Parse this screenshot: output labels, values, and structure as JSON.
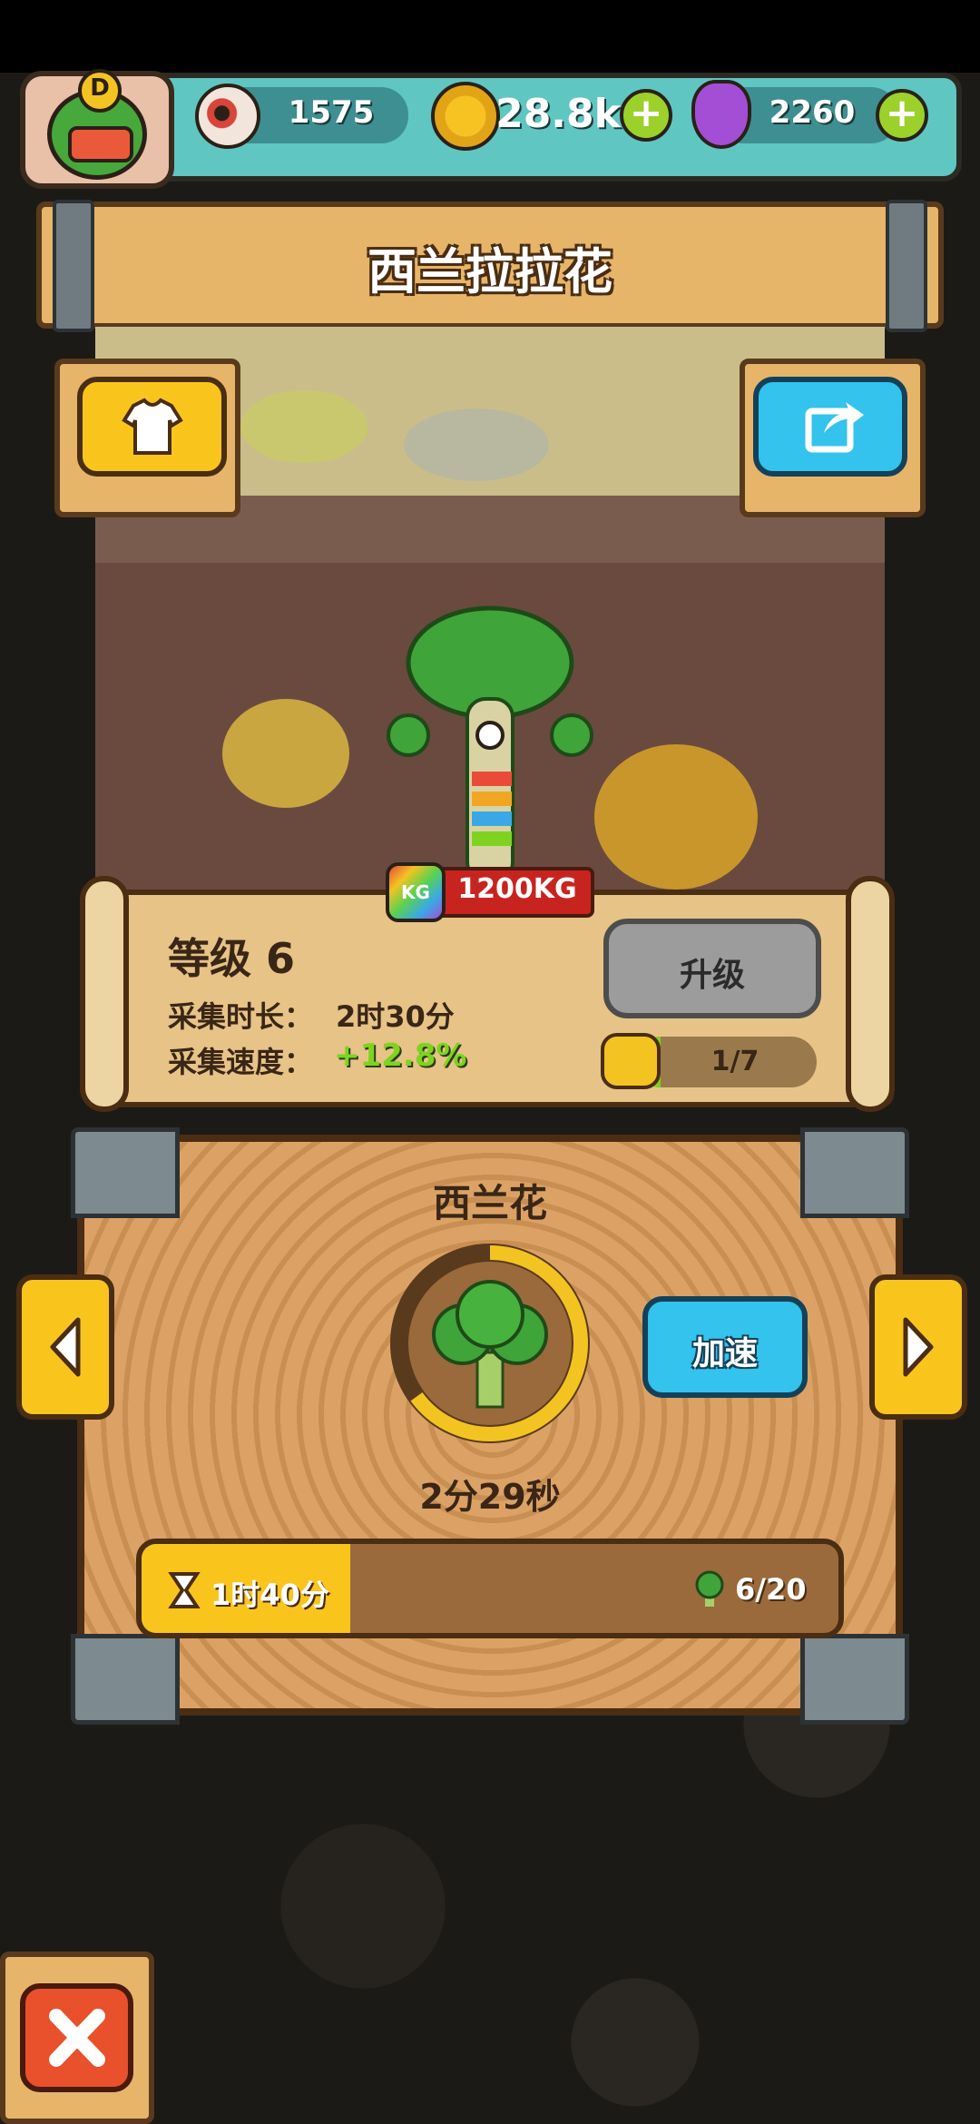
{
  "resources": {
    "eyeball": {
      "value": "1575",
      "icon": "eyeball-icon"
    },
    "coins": {
      "value": "28.8k",
      "icon": "gold-coin-icon"
    },
    "potion": {
      "value": "2260",
      "icon": "purple-potion-icon"
    }
  },
  "avatar_badge": "D",
  "title": "西兰拉拉花",
  "weight": "1200KG",
  "weight_icon_text": "KG",
  "level": {
    "label": "等级 6",
    "duration_label": "采集时长：",
    "duration_value": "2时30分",
    "speed_label": "采集速度：",
    "speed_value": "+12.8%",
    "upgrade_button": "升级",
    "upgrade_progress": "1/7",
    "upgrade_progress_fraction": 0.14
  },
  "crop": {
    "name": "西兰花",
    "timer": "2分29秒",
    "ring_progress": 0.65,
    "speedup_button": "加速",
    "total_time": "1时40分",
    "count": "6/20",
    "bar_progress": 0.3
  },
  "colors": {
    "accent_green": "#7ed321",
    "wood": "#e6b56a",
    "button_blue": "#33c3ec",
    "button_yellow": "#f9c51d"
  }
}
